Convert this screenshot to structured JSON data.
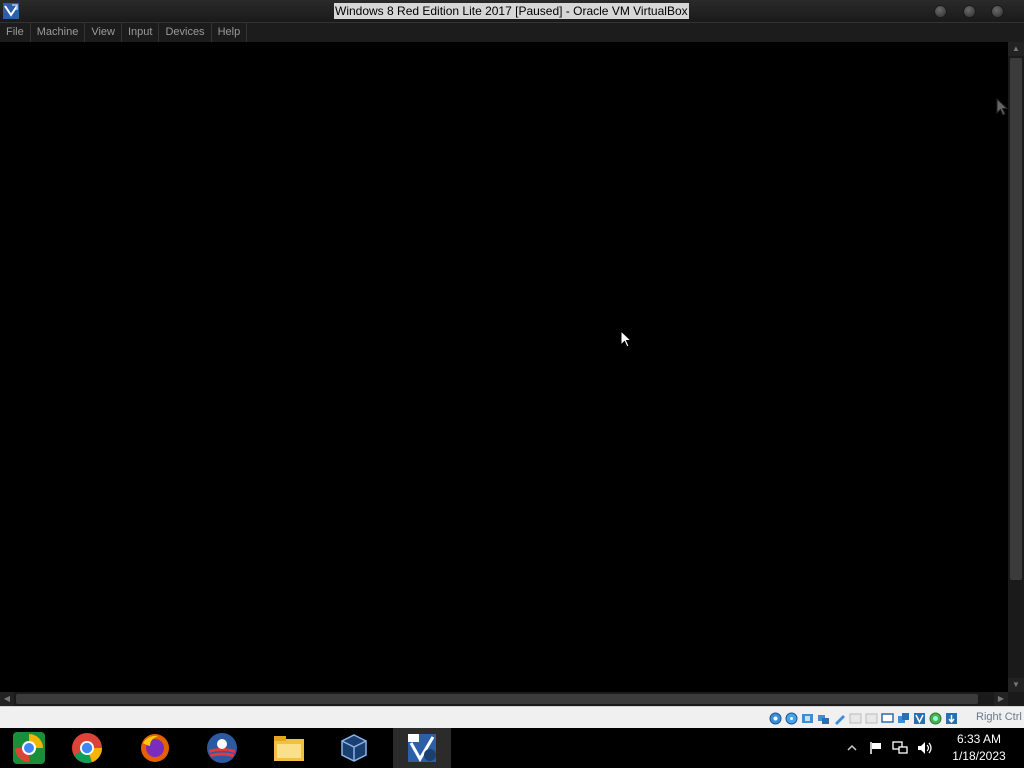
{
  "window": {
    "title": "Windows 8 Red Edition Lite 2017 [Paused] - Oracle VM VirtualBox",
    "icon": "virtualbox-app-icon"
  },
  "menu": {
    "items": [
      "File",
      "Machine",
      "View",
      "Input",
      "Devices",
      "Help"
    ]
  },
  "statusbar": {
    "icons": [
      "hard-disk-icon",
      "optical-drive-icon",
      "audio-icon",
      "network-icon",
      "usb-icon",
      "shared-folders-icon",
      "display-icon",
      "video-capture-icon",
      "guest-additions-icon",
      "cpu-virtualization-icon",
      "mouse-integration-icon",
      "keyboard-capture-icon"
    ],
    "host_key": "Right Ctrl"
  },
  "taskbar": {
    "apps": [
      "chrome-canary-icon",
      "chrome-icon",
      "firefox-icon",
      "obama-logo-icon",
      "file-explorer-icon",
      "virtualbox-icon",
      "windows-8-vm-icon"
    ],
    "tray": [
      "show-hidden-icons-chevron",
      "action-center-flag-icon",
      "network-icon",
      "volume-icon"
    ],
    "clock": {
      "time": "6:33 AM",
      "date": "1/18/2023"
    }
  },
  "colors": {
    "vm_background": "#000000",
    "menubar": "#1c1c1c",
    "statusbar": "#f0f0f0",
    "taskbar": "#000000"
  }
}
